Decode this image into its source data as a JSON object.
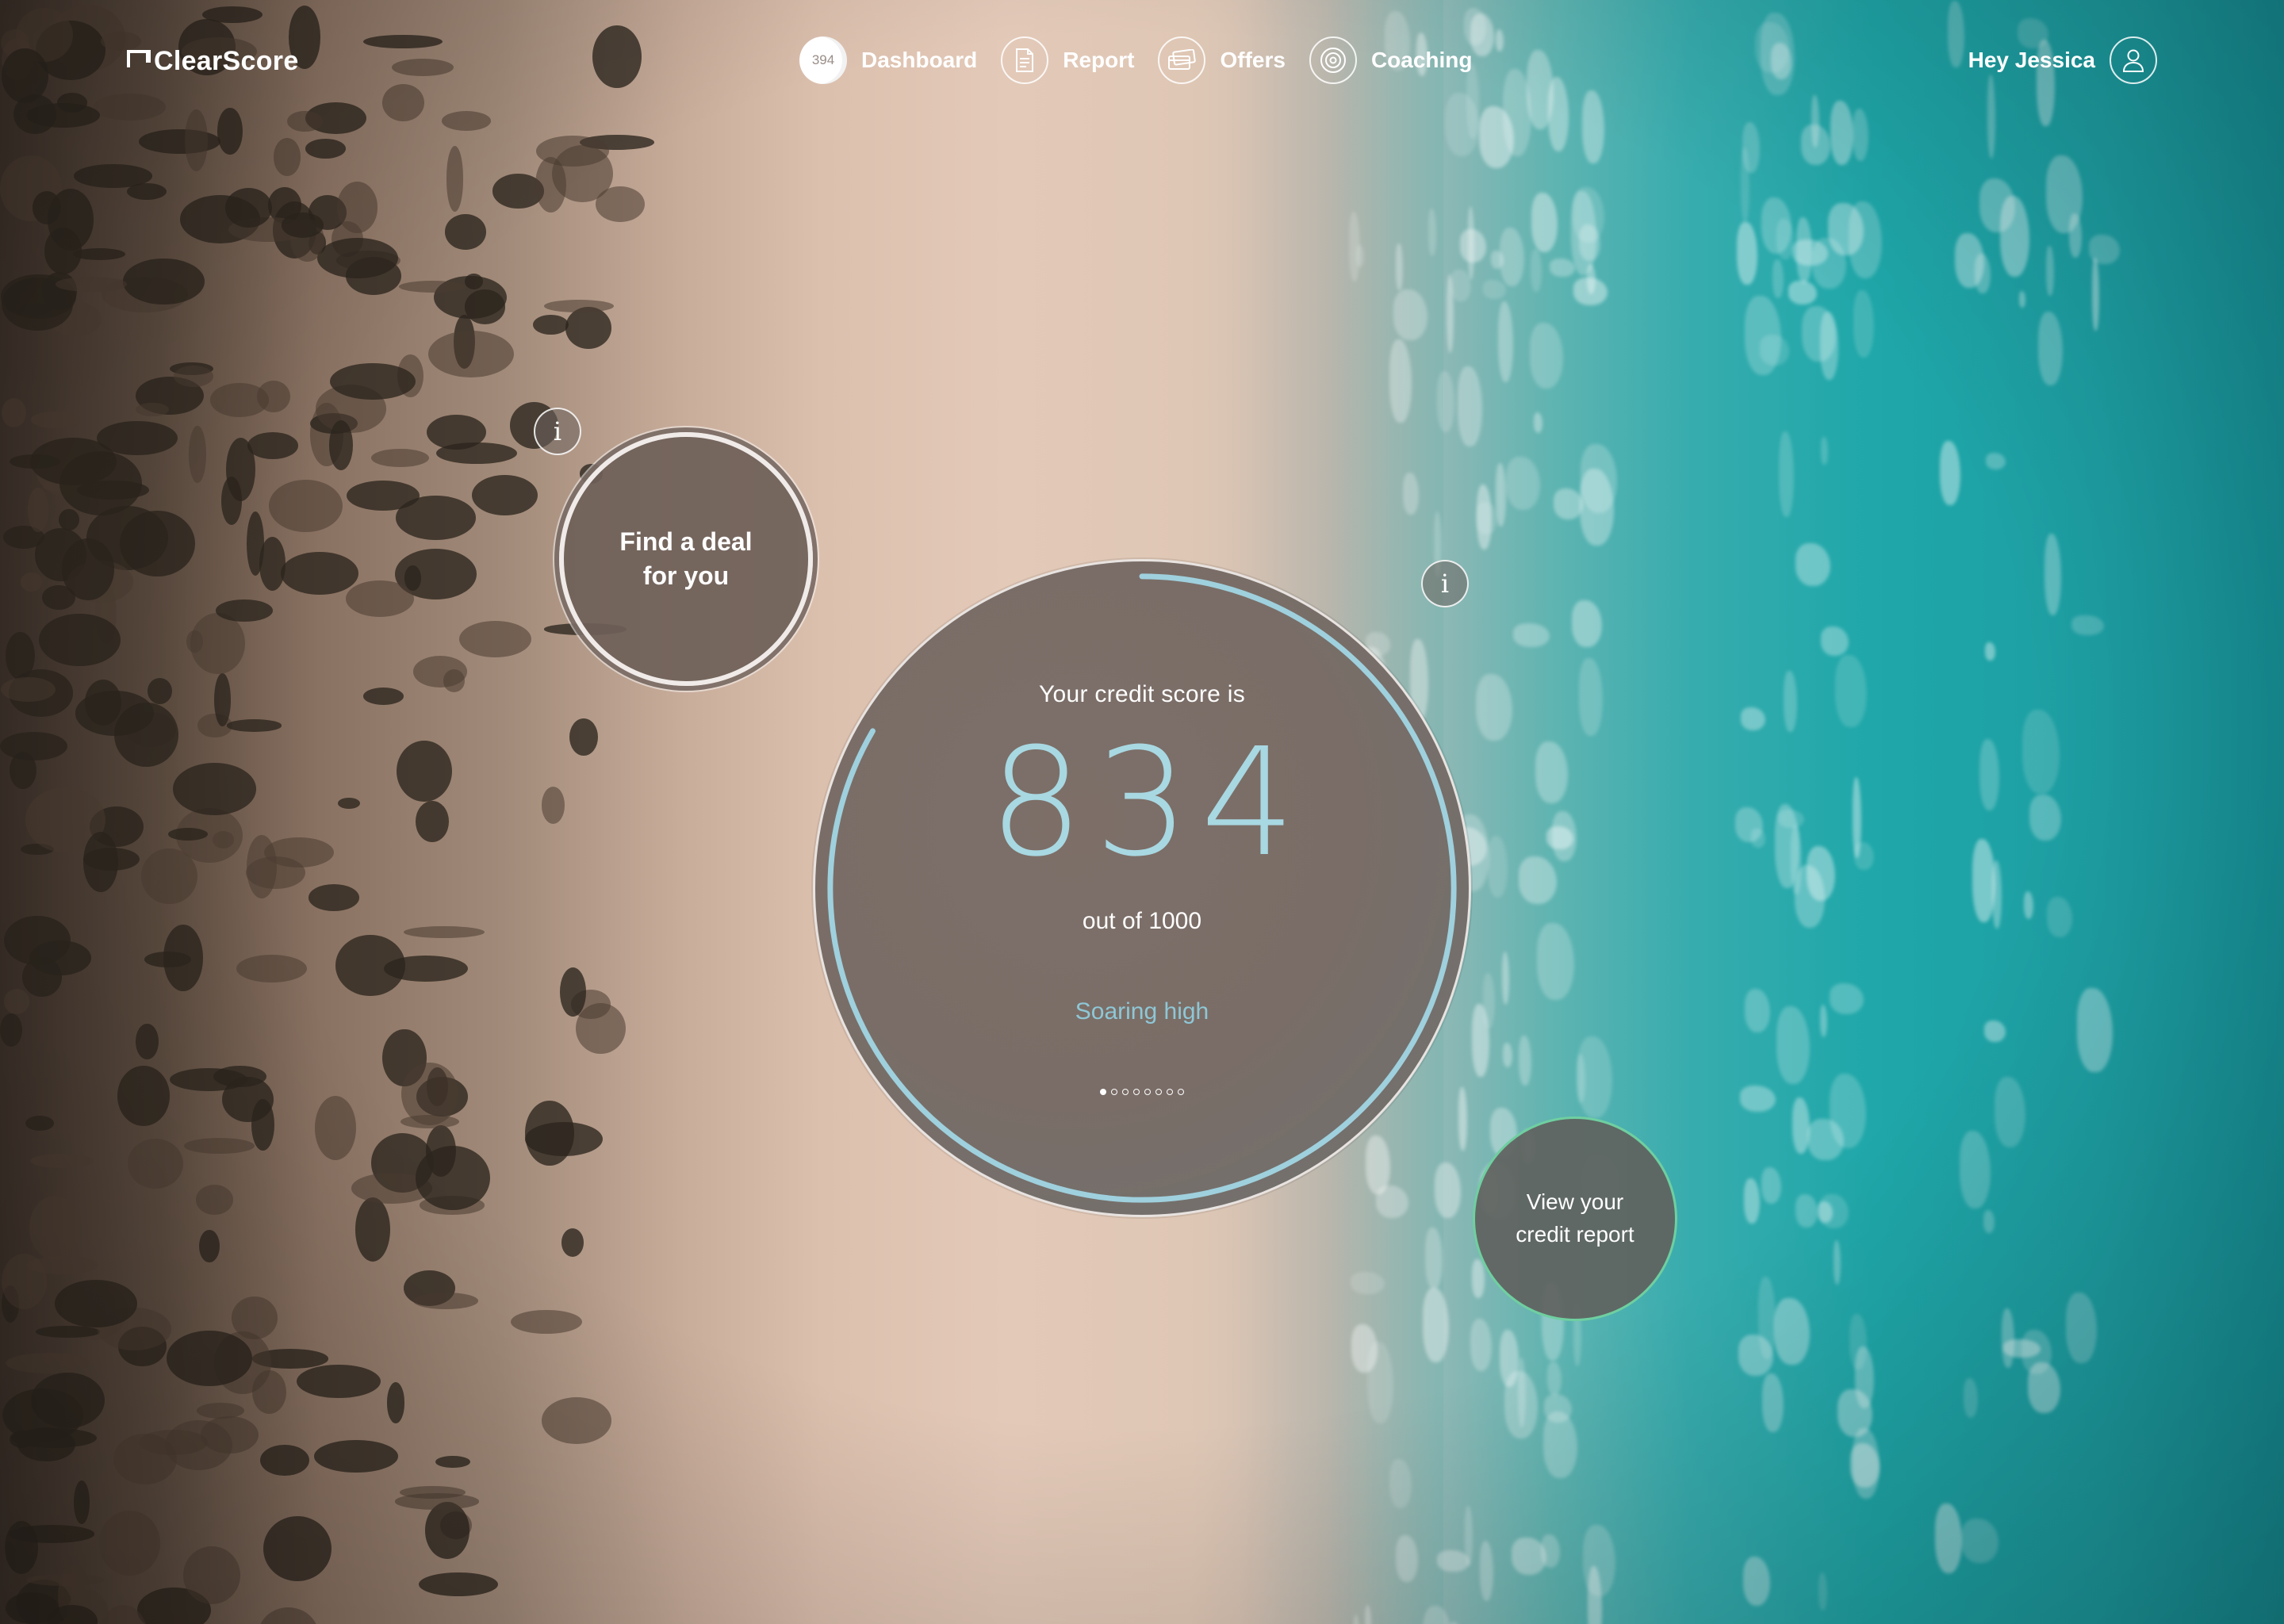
{
  "app": {
    "brand": "ClearScore"
  },
  "nav": {
    "items": [
      {
        "label": "Dashboard",
        "icon": "score-badge-icon",
        "badge": "394"
      },
      {
        "label": "Report",
        "icon": "document-icon"
      },
      {
        "label": "Offers",
        "icon": "cards-icon"
      },
      {
        "label": "Coaching",
        "icon": "target-icon"
      }
    ]
  },
  "user": {
    "greeting": "Hey Jessica",
    "icon": "user-icon"
  },
  "deal_bubble": {
    "line1": "Find a deal",
    "line2": "for you"
  },
  "score": {
    "label": "Your credit score is",
    "value": "834",
    "out_of": "out of 1000",
    "status": "Soaring high",
    "progress": 0.834,
    "pages": 8,
    "active_page": 0
  },
  "report_bubble": {
    "line1": "View your",
    "line2": "credit report"
  },
  "info": {
    "glyph": "i"
  },
  "colors": {
    "accent": "#a8d8e2",
    "ring": "#9fd0dd",
    "report_border": "#6fcfa0",
    "bubble_bg": "#7a6d67"
  }
}
